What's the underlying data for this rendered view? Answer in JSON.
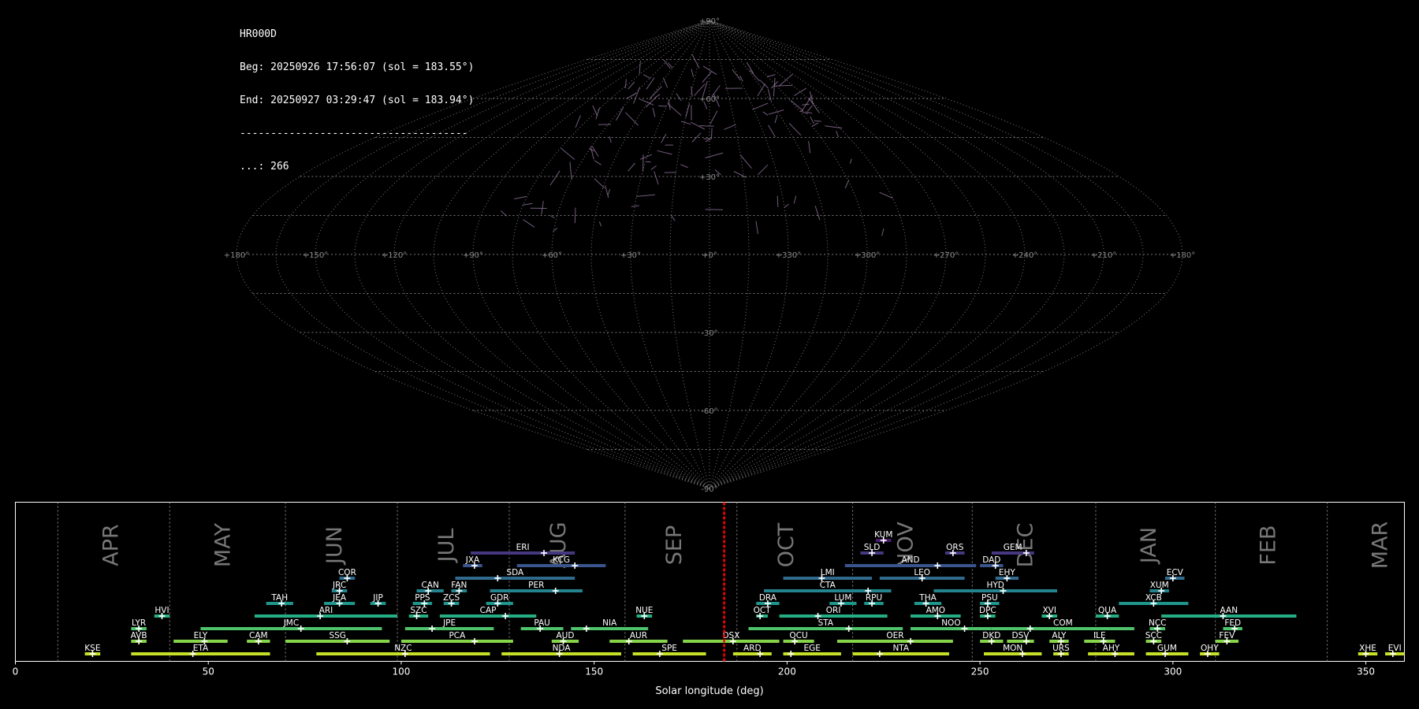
{
  "header": {
    "station": "HR000D",
    "beg": "Beg: 20250926 17:56:07 (sol = 183.55°)",
    "end": "End: 20250927 03:29:47 (sol = 183.94°)",
    "separator": "-------------------------------------",
    "count": "...: 266"
  },
  "sky_map": {
    "projection": "sinusoidal",
    "lat_labels": [
      "+90°",
      "+60°",
      "+30°",
      "-30°",
      "-60°",
      "-90°"
    ],
    "lon_labels": [
      "+180°",
      "+150°",
      "+120°",
      "+90°",
      "+60°",
      "+30°",
      "+0°",
      "+330°",
      "+300°",
      "+270°",
      "+240°",
      "+210°",
      "+180°"
    ],
    "grid_color": "#777777",
    "meteor_color": "#9a7ba6"
  },
  "chart_data": {
    "type": "range",
    "xlabel": "Solar longitude (deg)",
    "xlim": [
      0,
      360
    ],
    "xticks": [
      "0",
      "50",
      "100",
      "150",
      "200",
      "250",
      "300",
      "350"
    ],
    "current_sol": 183.7,
    "months": [
      {
        "name": "APR",
        "start": 11,
        "label_at": 25
      },
      {
        "name": "MAY",
        "start": 40,
        "label_at": 54
      },
      {
        "name": "JUN",
        "start": 70,
        "label_at": 83
      },
      {
        "name": "JUL",
        "start": 99,
        "label_at": 112
      },
      {
        "name": "AUG",
        "start": 128,
        "label_at": 141
      },
      {
        "name": "SEP",
        "start": 158,
        "label_at": 171
      },
      {
        "name": "OCT",
        "start": 187,
        "label_at": 200
      },
      {
        "name": "NOV",
        "start": 217,
        "label_at": 231
      },
      {
        "name": "DEC",
        "start": 248,
        "label_at": 262
      },
      {
        "name": "JAN",
        "start": 280,
        "label_at": 294
      },
      {
        "name": "FEB",
        "start": 311,
        "label_at": 325
      },
      {
        "name": "MAR",
        "start": 340,
        "label_at": 354
      }
    ],
    "showers": [
      {
        "code": "KSE",
        "start": 18,
        "end": 22,
        "peak": 20,
        "row": 0
      },
      {
        "code": "ETA",
        "start": 30,
        "end": 66,
        "peak": 46,
        "row": 0
      },
      {
        "code": "NZC",
        "start": 78,
        "end": 123,
        "peak": 101,
        "row": 0
      },
      {
        "code": "NDA",
        "start": 126,
        "end": 157,
        "peak": 141,
        "row": 0
      },
      {
        "code": "SPE",
        "start": 160,
        "end": 179,
        "peak": 167,
        "row": 0
      },
      {
        "code": "ARD",
        "start": 186,
        "end": 196,
        "peak": 193,
        "row": 0
      },
      {
        "code": "EGE",
        "start": 199,
        "end": 214,
        "peak": 201,
        "row": 0
      },
      {
        "code": "NTA",
        "start": 217,
        "end": 242,
        "peak": 224,
        "row": 0
      },
      {
        "code": "MON",
        "start": 251,
        "end": 266,
        "peak": 261,
        "row": 0
      },
      {
        "code": "URS",
        "start": 269,
        "end": 273,
        "peak": 271,
        "row": 0
      },
      {
        "code": "AHY",
        "start": 278,
        "end": 290,
        "peak": 285,
        "row": 0
      },
      {
        "code": "GUM",
        "start": 293,
        "end": 304,
        "peak": 298,
        "row": 0
      },
      {
        "code": "OHY",
        "start": 307,
        "end": 312,
        "peak": 309,
        "row": 0
      },
      {
        "code": "XHE",
        "start": 348,
        "end": 353,
        "peak": 350,
        "row": 0
      },
      {
        "code": "EVI",
        "start": 355,
        "end": 360,
        "peak": 357,
        "row": 0
      },
      {
        "code": "AVB",
        "start": 30,
        "end": 34,
        "peak": 32,
        "row": 1
      },
      {
        "code": "ELY",
        "start": 41,
        "end": 55,
        "peak": 49,
        "row": 1
      },
      {
        "code": "CAM",
        "start": 60,
        "end": 66,
        "peak": 63,
        "row": 1
      },
      {
        "code": "SSG",
        "start": 70,
        "end": 97,
        "peak": 86,
        "row": 1
      },
      {
        "code": "PCA",
        "start": 100,
        "end": 129,
        "peak": 119,
        "row": 1
      },
      {
        "code": "AUD",
        "start": 139,
        "end": 146,
        "peak": 142,
        "row": 1
      },
      {
        "code": "AUR",
        "start": 154,
        "end": 169,
        "peak": 159,
        "row": 1
      },
      {
        "code": "DSX",
        "start": 173,
        "end": 198,
        "peak": 186,
        "row": 1
      },
      {
        "code": "OCU",
        "start": 199,
        "end": 207,
        "peak": 202,
        "row": 1
      },
      {
        "code": "OER",
        "start": 213,
        "end": 243,
        "peak": 232,
        "row": 1
      },
      {
        "code": "DKD",
        "start": 250,
        "end": 256,
        "peak": 253,
        "row": 1
      },
      {
        "code": "DSV",
        "start": 257,
        "end": 264,
        "peak": 262,
        "row": 1
      },
      {
        "code": "ALY",
        "start": 268,
        "end": 273,
        "peak": 271,
        "row": 1
      },
      {
        "code": "ILE",
        "start": 277,
        "end": 285,
        "peak": 282,
        "row": 1
      },
      {
        "code": "SCC",
        "start": 293,
        "end": 297,
        "peak": 295,
        "row": 1
      },
      {
        "code": "FEV",
        "start": 311,
        "end": 317,
        "peak": 314,
        "row": 1
      },
      {
        "code": "LYR",
        "start": 30,
        "end": 34,
        "peak": 32,
        "row": 2
      },
      {
        "code": "JMC",
        "start": 48,
        "end": 95,
        "peak": 74,
        "row": 2
      },
      {
        "code": "JPE",
        "start": 101,
        "end": 124,
        "peak": 108,
        "row": 2
      },
      {
        "code": "PAU",
        "start": 131,
        "end": 142,
        "peak": 136,
        "row": 2
      },
      {
        "code": "NIA",
        "start": 144,
        "end": 164,
        "peak": 148,
        "row": 2
      },
      {
        "code": "STA",
        "start": 190,
        "end": 230,
        "peak": 216,
        "row": 2
      },
      {
        "code": "NOO",
        "start": 232,
        "end": 253,
        "peak": 246,
        "row": 2
      },
      {
        "code": "COM",
        "start": 253,
        "end": 290,
        "peak": 263,
        "row": 2
      },
      {
        "code": "NCC",
        "start": 294,
        "end": 298,
        "peak": 296,
        "row": 2
      },
      {
        "code": "FED",
        "start": 313,
        "end": 318,
        "peak": 316,
        "row": 2
      },
      {
        "code": "HVI",
        "start": 36,
        "end": 40,
        "peak": 38,
        "row": 3
      },
      {
        "code": "ARI",
        "start": 62,
        "end": 99,
        "peak": 79,
        "row": 3
      },
      {
        "code": "SZC",
        "start": 102,
        "end": 107,
        "peak": 104,
        "row": 3
      },
      {
        "code": "CAP",
        "start": 110,
        "end": 135,
        "peak": 127,
        "row": 3
      },
      {
        "code": "NUE",
        "start": 161,
        "end": 165,
        "peak": 163,
        "row": 3
      },
      {
        "code": "OCT",
        "start": 192,
        "end": 195,
        "peak": 193,
        "row": 3
      },
      {
        "code": "ORI",
        "start": 198,
        "end": 226,
        "peak": 208,
        "row": 3
      },
      {
        "code": "AMO",
        "start": 232,
        "end": 245,
        "peak": 239,
        "row": 3
      },
      {
        "code": "DPC",
        "start": 250,
        "end": 254,
        "peak": 252,
        "row": 3
      },
      {
        "code": "XVI",
        "start": 266,
        "end": 270,
        "peak": 268,
        "row": 3
      },
      {
        "code": "QUA",
        "start": 280,
        "end": 286,
        "peak": 283,
        "row": 3
      },
      {
        "code": "AAN",
        "start": 297,
        "end": 332,
        "peak": 313,
        "row": 3
      },
      {
        "code": "TAH",
        "start": 65,
        "end": 72,
        "peak": 69,
        "row": 4
      },
      {
        "code": "JEA",
        "start": 80,
        "end": 88,
        "peak": 84,
        "row": 4
      },
      {
        "code": "JIP",
        "start": 92,
        "end": 96,
        "peak": 94,
        "row": 4
      },
      {
        "code": "PPS",
        "start": 103,
        "end": 108,
        "peak": 106,
        "row": 4
      },
      {
        "code": "ZCS",
        "start": 111,
        "end": 115,
        "peak": 113,
        "row": 4
      },
      {
        "code": "GDR",
        "start": 122,
        "end": 129,
        "peak": 125,
        "row": 4
      },
      {
        "code": "DRA",
        "start": 192,
        "end": 198,
        "peak": 195,
        "row": 4
      },
      {
        "code": "LUM",
        "start": 211,
        "end": 218,
        "peak": 214,
        "row": 4
      },
      {
        "code": "RPU",
        "start": 220,
        "end": 225,
        "peak": 222,
        "row": 4
      },
      {
        "code": "THA",
        "start": 233,
        "end": 240,
        "peak": 236,
        "row": 4
      },
      {
        "code": "PSU",
        "start": 250,
        "end": 255,
        "peak": 252,
        "row": 4
      },
      {
        "code": "XCB",
        "start": 286,
        "end": 304,
        "peak": 295,
        "row": 4
      },
      {
        "code": "JRC",
        "start": 82,
        "end": 86,
        "peak": 84,
        "row": 5
      },
      {
        "code": "CAN",
        "start": 104,
        "end": 111,
        "peak": 107,
        "row": 5
      },
      {
        "code": "FAN",
        "start": 113,
        "end": 117,
        "peak": 115,
        "row": 5
      },
      {
        "code": "PER",
        "start": 123,
        "end": 147,
        "peak": 140,
        "row": 5
      },
      {
        "code": "CTA",
        "start": 194,
        "end": 227,
        "peak": 221,
        "row": 5
      },
      {
        "code": "HYD",
        "start": 238,
        "end": 270,
        "peak": 256,
        "row": 5
      },
      {
        "code": "XUM",
        "start": 294,
        "end": 299,
        "peak": 297,
        "row": 5
      },
      {
        "code": "COR",
        "start": 84,
        "end": 88,
        "peak": 86,
        "row": 6
      },
      {
        "code": "SDA",
        "start": 114,
        "end": 145,
        "peak": 125,
        "row": 6
      },
      {
        "code": "LMI",
        "start": 199,
        "end": 222,
        "peak": 209,
        "row": 6
      },
      {
        "code": "LEO",
        "start": 224,
        "end": 246,
        "peak": 235,
        "row": 6
      },
      {
        "code": "EHY",
        "start": 254,
        "end": 260,
        "peak": 257,
        "row": 6
      },
      {
        "code": "ECV",
        "start": 298,
        "end": 303,
        "peak": 300,
        "row": 6
      },
      {
        "code": "JXA",
        "start": 116,
        "end": 121,
        "peak": 119,
        "row": 7
      },
      {
        "code": "KCG",
        "start": 130,
        "end": 153,
        "peak": 145,
        "row": 7
      },
      {
        "code": "AND",
        "start": 215,
        "end": 249,
        "peak": 239,
        "row": 7
      },
      {
        "code": "DAD",
        "start": 250,
        "end": 256,
        "peak": 254,
        "row": 7
      },
      {
        "code": "ERI",
        "start": 118,
        "end": 145,
        "peak": 137,
        "row": 8
      },
      {
        "code": "SLD",
        "start": 219,
        "end": 225,
        "peak": 222,
        "row": 8
      },
      {
        "code": "ORS",
        "start": 241,
        "end": 246,
        "peak": 243,
        "row": 8
      },
      {
        "code": "GEM",
        "start": 253,
        "end": 264,
        "peak": 262,
        "row": 8
      },
      {
        "code": "KUM",
        "start": 223,
        "end": 227,
        "peak": 225,
        "row": 9
      }
    ]
  }
}
